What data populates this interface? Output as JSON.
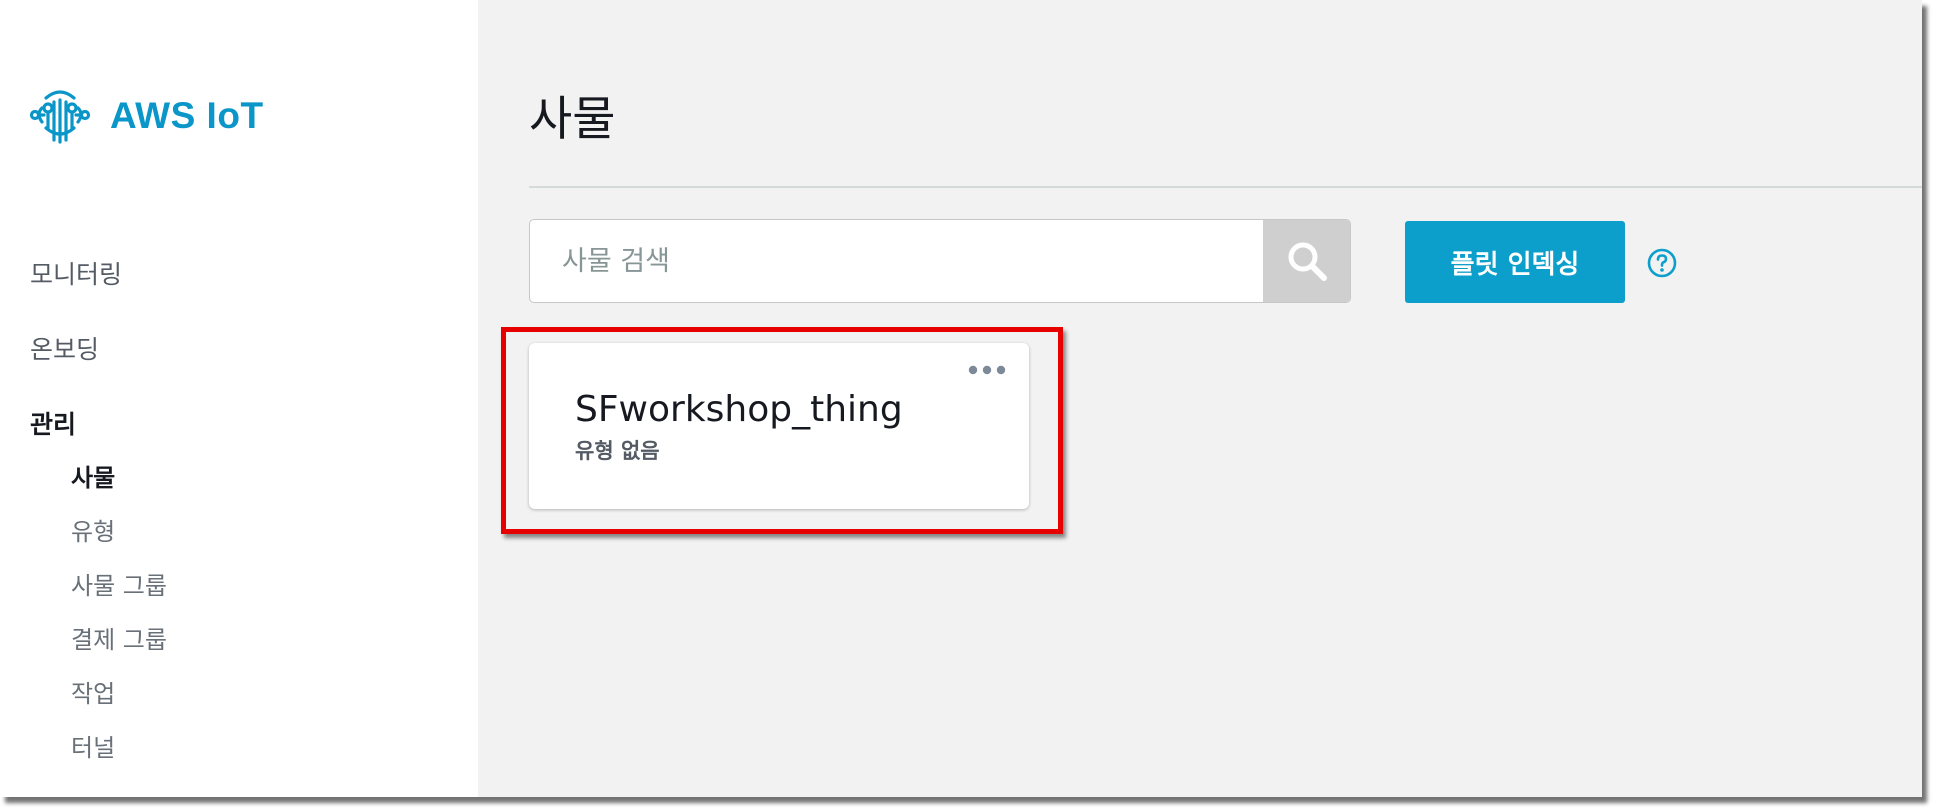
{
  "brand": {
    "name": "AWS IoT",
    "color": "#0a96c8",
    "icon": "aws-iot-logo-icon"
  },
  "sidebar": {
    "items": [
      {
        "label": "모니터링"
      },
      {
        "label": "온보딩"
      }
    ],
    "section": {
      "label": "관리",
      "children": [
        {
          "label": "사물",
          "active": true
        },
        {
          "label": "유형"
        },
        {
          "label": "사물 그룹"
        },
        {
          "label": "결제 그룹"
        },
        {
          "label": "작업"
        },
        {
          "label": "터널"
        }
      ]
    }
  },
  "main": {
    "title": "사물",
    "search": {
      "placeholder": "사물 검색",
      "value": "",
      "icon": "search-icon"
    },
    "fleet_indexing_button": {
      "label": "플릿 인덱싱",
      "color": "#0d9fcc"
    },
    "help_icon": "help-circle-icon",
    "things": [
      {
        "name": "SFworkshop_thing",
        "type": "유형 없음",
        "menu_icon": "more-horizontal-icon"
      }
    ]
  },
  "annotation": {
    "color": "#e60000"
  }
}
